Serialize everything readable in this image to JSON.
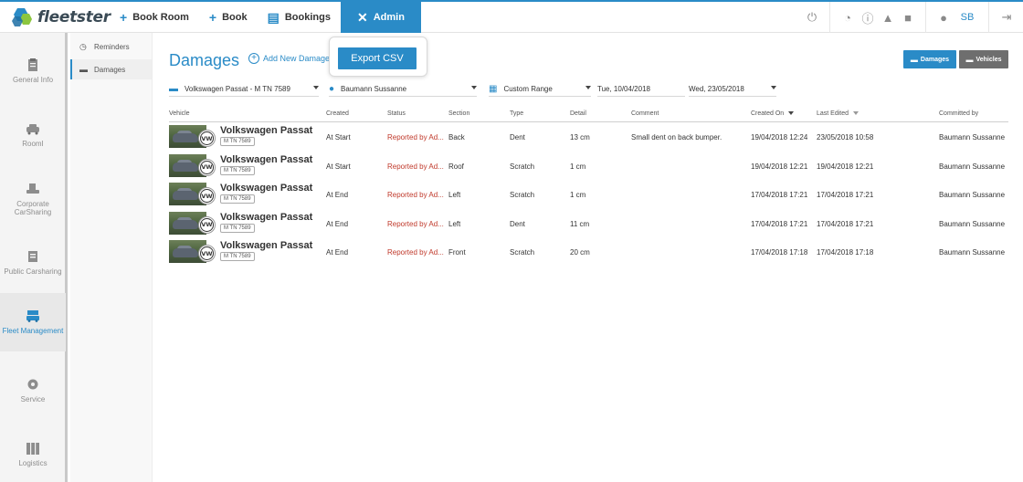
{
  "app": {
    "logo_text": "fleetster"
  },
  "topnav": [
    {
      "icon": "plus-icon",
      "glyph": "+",
      "label": "Book Room"
    },
    {
      "icon": "plus-icon",
      "glyph": "+",
      "label": "Book"
    },
    {
      "icon": "clipboard-icon",
      "glyph": "▤",
      "label": "Bookings"
    },
    {
      "icon": "tools-icon",
      "glyph": "✕",
      "label": "Admin",
      "active": true
    }
  ],
  "topicons": {
    "user_initials": "SB"
  },
  "sidebar": {
    "items": [
      {
        "label": "General Info"
      },
      {
        "label": "RoomI"
      },
      {
        "label": "Corporate CarSharing"
      },
      {
        "label": "Public Carsharing"
      },
      {
        "label": "Fleet Management",
        "active": true
      },
      {
        "label": "Service"
      },
      {
        "label": "Logistics"
      }
    ]
  },
  "subnav": {
    "items": [
      {
        "label": "Reminders"
      },
      {
        "label": "Damages",
        "active": true
      }
    ]
  },
  "main": {
    "title": "Damages",
    "add_new_label": "Add New Damage",
    "export_label": "Export CSV",
    "toggle_damages": "Damages",
    "toggle_vehicles": "Vehicles"
  },
  "filters": {
    "vehicle": "Volkswagen Passat - M TN 7589",
    "user": "Baumann Sussanne",
    "range": "Custom Range",
    "date_from": "Tue, 10/04/2018",
    "date_to": "Wed, 23/05/2018"
  },
  "table": {
    "headers": {
      "vehicle": "Vehicle",
      "created": "Created",
      "status": "Status",
      "section": "Section",
      "type": "Type",
      "detail": "Detail",
      "comment": "Comment",
      "created_on": "Created On",
      "last_edited": "Last Edited",
      "committed_by": "Committed by"
    },
    "rows": [
      {
        "vehicle": "Volkswagen Passat",
        "plate": "M TN 7589",
        "created": "At Start",
        "status": "Reported by Ad...",
        "section": "Back",
        "type": "Dent",
        "detail": "13 cm",
        "comment": "Small dent on back bumper.",
        "created_on": "19/04/2018 12:24",
        "last_edited": "23/05/2018 10:58",
        "committed_by": "Baumann Sussanne"
      },
      {
        "vehicle": "Volkswagen Passat",
        "plate": "M TN 7589",
        "created": "At Start",
        "status": "Reported by Ad...",
        "section": "Roof",
        "type": "Scratch",
        "detail": "1 cm",
        "comment": "",
        "created_on": "19/04/2018 12:21",
        "last_edited": "19/04/2018 12:21",
        "committed_by": "Baumann Sussanne"
      },
      {
        "vehicle": "Volkswagen Passat",
        "plate": "M TN 7589",
        "created": "At End",
        "status": "Reported by Ad...",
        "section": "Left",
        "type": "Scratch",
        "detail": "1 cm",
        "comment": "",
        "created_on": "17/04/2018 17:21",
        "last_edited": "17/04/2018 17:21",
        "committed_by": "Baumann Sussanne"
      },
      {
        "vehicle": "Volkswagen Passat",
        "plate": "M TN 7589",
        "created": "At End",
        "status": "Reported by Ad...",
        "section": "Left",
        "type": "Dent",
        "detail": "11 cm",
        "comment": "",
        "created_on": "17/04/2018 17:21",
        "last_edited": "17/04/2018 17:21",
        "committed_by": "Baumann Sussanne"
      },
      {
        "vehicle": "Volkswagen Passat",
        "plate": "M TN 7589",
        "created": "At End",
        "status": "Reported by Ad...",
        "section": "Front",
        "type": "Scratch",
        "detail": "20 cm",
        "comment": "",
        "created_on": "17/04/2018 17:18",
        "last_edited": "17/04/2018 17:18",
        "committed_by": "Baumann Sussanne"
      }
    ]
  },
  "colors": {
    "accent": "#2a8bc7",
    "status": "#c0392b",
    "vehicles_toggle": "#6e6e6e"
  }
}
